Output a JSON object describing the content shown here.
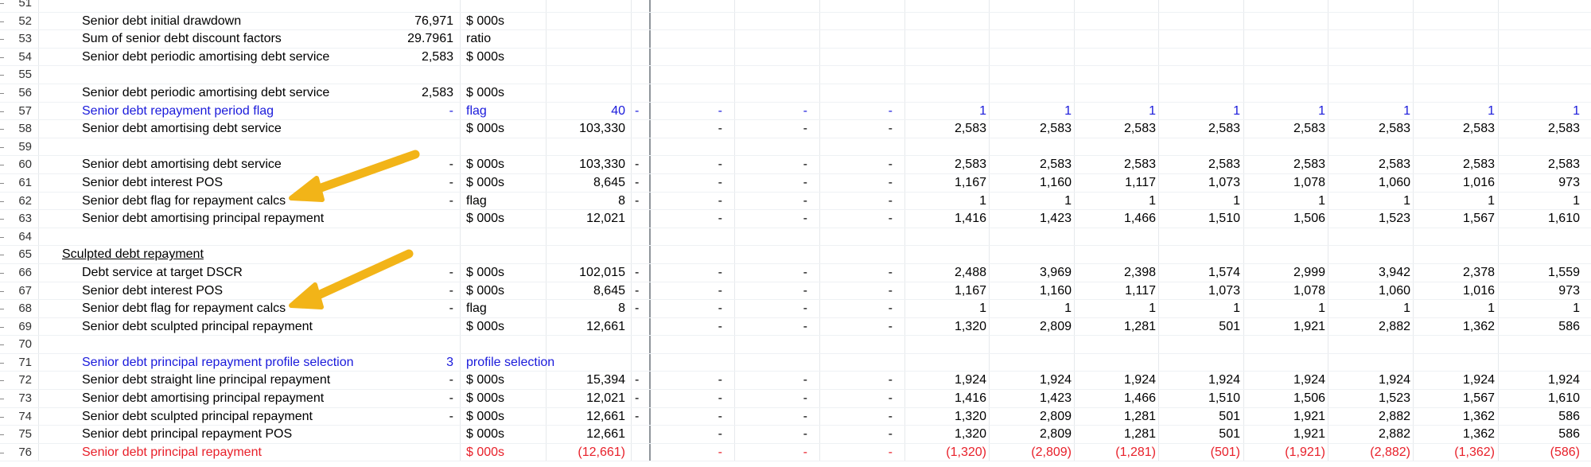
{
  "colors": {
    "label": "#000000",
    "input_blue": "#1a1adb",
    "output_red": "#e8202a",
    "arrow": "#f2b418"
  },
  "arrow_icon": "orange-callout-arrow",
  "rows": [
    {
      "n": "51",
      "label": "",
      "input": "",
      "unit": "",
      "total": "",
      "dash": "",
      "periods": [
        "",
        "",
        "",
        "",
        "",
        "",
        "",
        "",
        "",
        "",
        ""
      ]
    },
    {
      "n": "52",
      "label": "Senior debt initial drawdown",
      "input": "76,971",
      "unit": "$ 000s",
      "total": "",
      "dash": "",
      "periods": [
        "",
        "",
        "",
        "",
        "",
        "",
        "",
        "",
        "",
        "",
        ""
      ]
    },
    {
      "n": "53",
      "label": "Sum of senior debt discount factors",
      "input": "29.7961",
      "unit": "ratio",
      "total": "",
      "dash": "",
      "periods": [
        "",
        "",
        "",
        "",
        "",
        "",
        "",
        "",
        "",
        "",
        ""
      ]
    },
    {
      "n": "54",
      "label": "Senior debt periodic amortising debt service",
      "input": "2,583",
      "unit": "$ 000s",
      "total": "",
      "dash": "",
      "periods": [
        "",
        "",
        "",
        "",
        "",
        "",
        "",
        "",
        "",
        "",
        ""
      ]
    },
    {
      "n": "55",
      "label": "",
      "input": "",
      "unit": "",
      "total": "",
      "dash": "",
      "periods": [
        "",
        "",
        "",
        "",
        "",
        "",
        "",
        "",
        "",
        "",
        ""
      ]
    },
    {
      "n": "56",
      "label": "Senior debt periodic amortising debt service",
      "input": "2,583",
      "unit": "$ 000s",
      "total": "",
      "dash": "",
      "periods": [
        "",
        "",
        "",
        "",
        "",
        "",
        "",
        "",
        "",
        "",
        ""
      ]
    },
    {
      "n": "57",
      "label": "Senior debt repayment period flag",
      "input": "-",
      "unit": "flag",
      "total": "40",
      "dash": "-",
      "style": "blue",
      "periods": [
        "-",
        "-",
        "-",
        "1",
        "1",
        "1",
        "1",
        "1",
        "1",
        "1",
        "1"
      ]
    },
    {
      "n": "58",
      "label": "Senior debt amortising debt service",
      "input": "",
      "unit": "$ 000s",
      "total": "103,330",
      "dash": "",
      "periods": [
        "-",
        "-",
        "-",
        "2,583",
        "2,583",
        "2,583",
        "2,583",
        "2,583",
        "2,583",
        "2,583",
        "2,583"
      ]
    },
    {
      "n": "59",
      "label": "",
      "input": "",
      "unit": "",
      "total": "",
      "dash": "",
      "periods": [
        "",
        "",
        "",
        "",
        "",
        "",
        "",
        "",
        "",
        "",
        ""
      ]
    },
    {
      "n": "60",
      "label": "Senior debt amortising debt service",
      "input": "-",
      "unit": "$ 000s",
      "total": "103,330",
      "dash": "-",
      "periods": [
        "-",
        "-",
        "-",
        "2,583",
        "2,583",
        "2,583",
        "2,583",
        "2,583",
        "2,583",
        "2,583",
        "2,583"
      ]
    },
    {
      "n": "61",
      "label": "Senior debt interest POS",
      "input": "-",
      "unit": "$ 000s",
      "total": "8,645",
      "dash": "-",
      "periods": [
        "-",
        "-",
        "-",
        "1,167",
        "1,160",
        "1,117",
        "1,073",
        "1,078",
        "1,060",
        "1,016",
        "973"
      ]
    },
    {
      "n": "62",
      "label": "Senior debt flag for repayment calcs",
      "input": "-",
      "unit": "flag",
      "total": "8",
      "dash": "-",
      "periods": [
        "-",
        "-",
        "-",
        "1",
        "1",
        "1",
        "1",
        "1",
        "1",
        "1",
        "1"
      ]
    },
    {
      "n": "63",
      "label": "Senior debt amortising principal repayment",
      "input": "",
      "unit": "$ 000s",
      "total": "12,021",
      "dash": "",
      "periods": [
        "-",
        "-",
        "-",
        "1,416",
        "1,423",
        "1,466",
        "1,510",
        "1,506",
        "1,523",
        "1,567",
        "1,610"
      ]
    },
    {
      "n": "64",
      "label": "",
      "input": "",
      "unit": "",
      "total": "",
      "dash": "",
      "periods": [
        "",
        "",
        "",
        "",
        "",
        "",
        "",
        "",
        "",
        "",
        ""
      ]
    },
    {
      "n": "65",
      "label": "Sculpted debt repayment",
      "input": "",
      "unit": "",
      "total": "",
      "dash": "",
      "style": "sec",
      "periods": [
        "",
        "",
        "",
        "",
        "",
        "",
        "",
        "",
        "",
        "",
        ""
      ]
    },
    {
      "n": "66",
      "label": "Debt service at target DSCR",
      "input": "-",
      "unit": "$ 000s",
      "total": "102,015",
      "dash": "-",
      "periods": [
        "-",
        "-",
        "-",
        "2,488",
        "3,969",
        "2,398",
        "1,574",
        "2,999",
        "3,942",
        "2,378",
        "1,559"
      ]
    },
    {
      "n": "67",
      "label": "Senior debt interest POS",
      "input": "-",
      "unit": "$ 000s",
      "total": "8,645",
      "dash": "-",
      "periods": [
        "-",
        "-",
        "-",
        "1,167",
        "1,160",
        "1,117",
        "1,073",
        "1,078",
        "1,060",
        "1,016",
        "973"
      ]
    },
    {
      "n": "68",
      "label": "Senior debt flag for repayment calcs",
      "input": "-",
      "unit": "flag",
      "total": "8",
      "dash": "-",
      "periods": [
        "-",
        "-",
        "-",
        "1",
        "1",
        "1",
        "1",
        "1",
        "1",
        "1",
        "1"
      ]
    },
    {
      "n": "69",
      "label": "Senior debt sculpted principal repayment",
      "input": "",
      "unit": "$ 000s",
      "total": "12,661",
      "dash": "",
      "periods": [
        "-",
        "-",
        "-",
        "1,320",
        "2,809",
        "1,281",
        "501",
        "1,921",
        "2,882",
        "1,362",
        "586"
      ]
    },
    {
      "n": "70",
      "label": "",
      "input": "",
      "unit": "",
      "total": "",
      "dash": "",
      "periods": [
        "",
        "",
        "",
        "",
        "",
        "",
        "",
        "",
        "",
        "",
        ""
      ]
    },
    {
      "n": "71",
      "label": "Senior debt principal repayment profile selection",
      "input": "3",
      "unit": "profile selection",
      "total": "",
      "dash": "",
      "style": "blue",
      "periods": [
        "",
        "",
        "",
        "",
        "",
        "",
        "",
        "",
        "",
        "",
        ""
      ]
    },
    {
      "n": "72",
      "label": "Senior debt straight line principal repayment",
      "input": "-",
      "unit": "$ 000s",
      "total": "15,394",
      "dash": "-",
      "periods": [
        "-",
        "-",
        "-",
        "1,924",
        "1,924",
        "1,924",
        "1,924",
        "1,924",
        "1,924",
        "1,924",
        "1,924"
      ]
    },
    {
      "n": "73",
      "label": "Senior debt amortising principal repayment",
      "input": "-",
      "unit": "$ 000s",
      "total": "12,021",
      "dash": "-",
      "periods": [
        "-",
        "-",
        "-",
        "1,416",
        "1,423",
        "1,466",
        "1,510",
        "1,506",
        "1,523",
        "1,567",
        "1,610"
      ]
    },
    {
      "n": "74",
      "label": "Senior debt sculpted principal repayment",
      "input": "-",
      "unit": "$ 000s",
      "total": "12,661",
      "dash": "-",
      "periods": [
        "-",
        "-",
        "-",
        "1,320",
        "2,809",
        "1,281",
        "501",
        "1,921",
        "2,882",
        "1,362",
        "586"
      ]
    },
    {
      "n": "75",
      "label": "Senior debt principal repayment POS",
      "input": "",
      "unit": "$ 000s",
      "total": "12,661",
      "dash": "",
      "periods": [
        "-",
        "-",
        "-",
        "1,320",
        "2,809",
        "1,281",
        "501",
        "1,921",
        "2,882",
        "1,362",
        "586"
      ]
    },
    {
      "n": "76",
      "label": "Senior debt principal repayment",
      "input": "",
      "unit": "$ 000s",
      "total": "(12,661)",
      "dash": "",
      "style": "red",
      "periods": [
        "-",
        "-",
        "-",
        "(1,320)",
        "(2,809)",
        "(1,281)",
        "(501)",
        "(1,921)",
        "(2,882)",
        "(1,362)",
        "(586)"
      ]
    }
  ]
}
